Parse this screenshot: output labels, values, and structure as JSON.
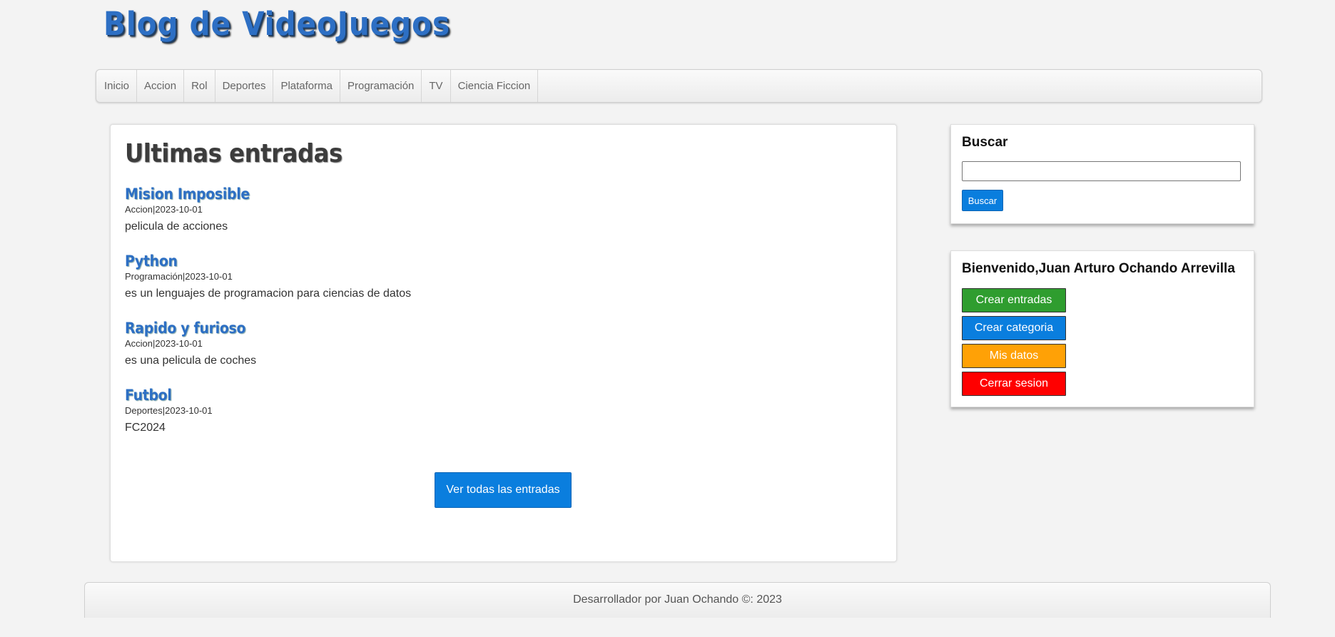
{
  "header": {
    "title": "Blog de VideoJuegos"
  },
  "nav": {
    "items": [
      "Inicio",
      "Accion",
      "Rol",
      "Deportes",
      "Plataforma",
      "Programación",
      "TV",
      "Ciencia Ficcion"
    ]
  },
  "main": {
    "title": "Ultimas entradas",
    "entries": [
      {
        "title": "Mision Imposible",
        "meta": "Accion|2023-10-01",
        "description": "pelicula de acciones"
      },
      {
        "title": "Python",
        "meta": "Programación|2023-10-01",
        "description": "es un lenguajes de programacion para ciencias de datos"
      },
      {
        "title": "Rapido y furioso",
        "meta": "Accion|2023-10-01",
        "description": "es una pelicula de coches"
      },
      {
        "title": "Futbol",
        "meta": "Deportes|2023-10-01",
        "description": "FC2024"
      }
    ],
    "view_all_label": "Ver todas las entradas"
  },
  "search": {
    "title": "Buscar",
    "value": "",
    "button_label": "Buscar"
  },
  "welcome": {
    "title": "Bienvenido,Juan Arturo Ochando Arrevilla",
    "buttons": {
      "create_entry": "Crear entradas",
      "create_category": "Crear categoria",
      "my_data": "Mis datos",
      "logout": "Cerrar sesion"
    }
  },
  "footer": {
    "text": "Desarrollador por Juan Ochando ©: 2023"
  }
}
